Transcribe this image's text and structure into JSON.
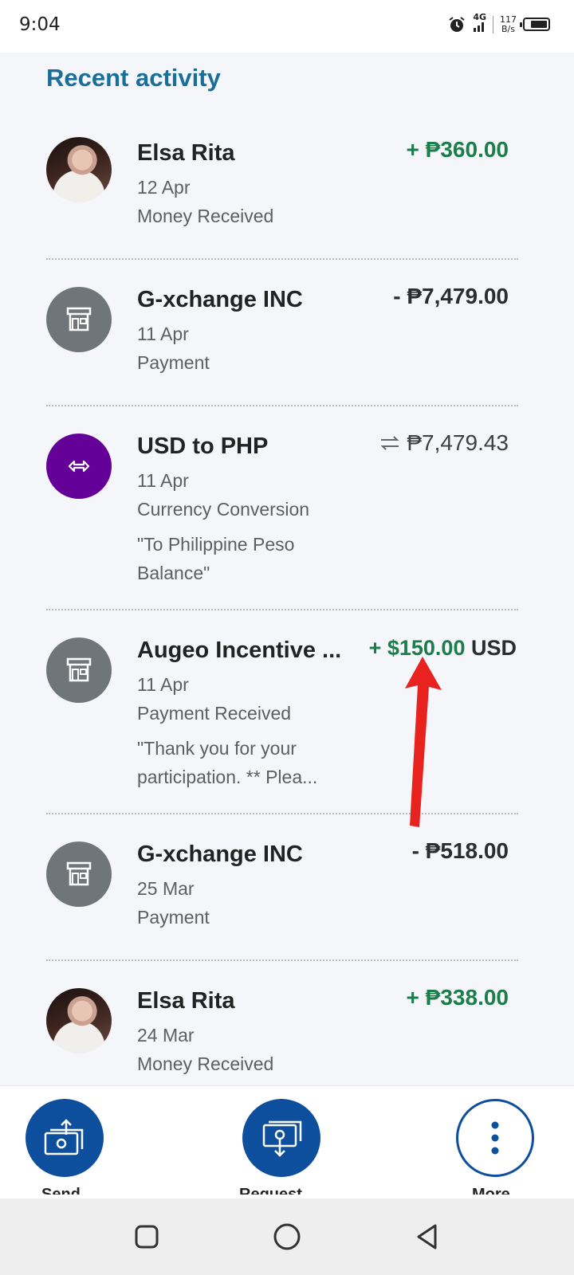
{
  "status_bar": {
    "time": "9:04",
    "network": "4G",
    "speed_value": "117",
    "speed_unit": "B/s",
    "battery_level": 0.75,
    "icons": [
      "alarm-icon",
      "signal-icon",
      "battery-icon"
    ]
  },
  "activity": {
    "title": "Recent activity",
    "transactions": [
      {
        "name": "Elsa Rita",
        "date": "12 Apr",
        "type": "Money Received",
        "note": "",
        "amount": "+ ₱360.00",
        "avatar": "photo"
      },
      {
        "name": "G-xchange INC",
        "date": "11 Apr",
        "type": "Payment",
        "note": "",
        "amount": "- ₱7,479.00",
        "avatar": "store-icon"
      },
      {
        "name": "USD to PHP",
        "date": "11 Apr",
        "type": "Currency Conversion",
        "note_line1": "\"To Philippine Peso",
        "note_line2": "Balance\"",
        "amount": "₱7,479.43",
        "avatar": "exchange-icon"
      },
      {
        "name": "Augeo Incentive ...",
        "date": "11 Apr",
        "type": "Payment Received",
        "note_line1": "\"Thank you for your",
        "note_line2": "participation. ** Plea...",
        "amount": "+ $150.00",
        "currency": "USD",
        "avatar": "store-icon"
      },
      {
        "name": "G-xchange INC",
        "date": "25 Mar",
        "type": "Payment",
        "note": "",
        "amount": "- ₱518.00",
        "avatar": "store-icon"
      },
      {
        "name": "Elsa Rita",
        "date": "24 Mar",
        "type": "Money Received",
        "note": "",
        "amount": "+ ₱338.00",
        "avatar": "photo"
      }
    ]
  },
  "bottom_actions": [
    {
      "label": "Send",
      "icon": "send-money-icon"
    },
    {
      "label": "Request",
      "icon": "request-money-icon"
    },
    {
      "label": "More",
      "icon": "more-icon"
    }
  ],
  "colors": {
    "title": "#1b6e9a",
    "positive": "#1b7d4a",
    "primary": "#0d4f9d",
    "exchange": "#640098",
    "annotation_arrow": "#e8231f"
  }
}
